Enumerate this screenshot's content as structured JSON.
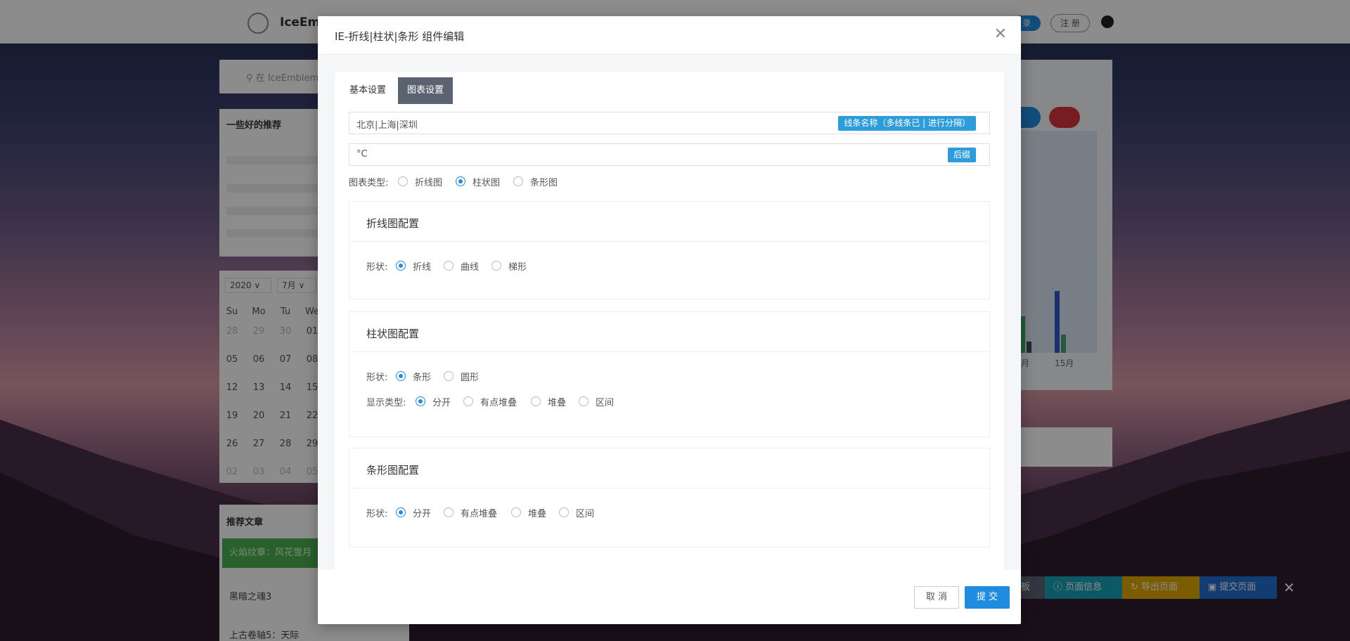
{
  "app": {
    "logo_text": "IceEml",
    "login_label": "录",
    "register_label": "注 册"
  },
  "sidebar": {
    "search_placeholder": "在 IceEmblem 中",
    "recommend_title": "一些好的推荐",
    "calendar": {
      "year": "2020",
      "month": "7月",
      "weekdays": [
        "Su",
        "Mo",
        "Tu",
        "We"
      ],
      "rows": [
        [
          "28",
          "29",
          "30",
          "01"
        ],
        [
          "05",
          "06",
          "07",
          "08"
        ],
        [
          "12",
          "13",
          "14",
          "15"
        ],
        [
          "19",
          "20",
          "21",
          "22"
        ],
        [
          "26",
          "27",
          "28",
          "29"
        ],
        [
          "02",
          "03",
          "04",
          "05"
        ]
      ]
    },
    "articles": {
      "title": "推荐文章",
      "highlight": "火焰纹章：风花雪月",
      "items": [
        "黑暗之魂3",
        "上古卷轴5：天际"
      ]
    }
  },
  "right_panel": {
    "axis_labels": [
      "月",
      "15月"
    ]
  },
  "bottom_bar": {
    "board_label": "板",
    "page_info": "页面信息",
    "export_label": "导出页面",
    "submit_page": "提交页面"
  },
  "modal": {
    "title": "IE-折线|柱状|条形 组件编辑",
    "tabs": [
      {
        "label": "基本设置"
      },
      {
        "label": "图表设置"
      }
    ],
    "series_field": {
      "value": "北京|上海|深圳",
      "tag": "线条名称（多线条已 | 进行分隔）"
    },
    "suffix_field": {
      "value": "°C",
      "tag": "后缀"
    },
    "chart_type": {
      "label": "图表类型:",
      "options": [
        "折线图",
        "柱状图",
        "条形图"
      ],
      "selected": "柱状图"
    },
    "line_config": {
      "title": "折线图配置",
      "shape": {
        "label": "形状:",
        "options": [
          "折线",
          "曲线",
          "梯形"
        ],
        "selected": "折线"
      }
    },
    "bar_config": {
      "title": "柱状图配置",
      "shape": {
        "label": "形状:",
        "options": [
          "条形",
          "圆形"
        ],
        "selected": "条形"
      },
      "display": {
        "label": "显示类型:",
        "options": [
          "分开",
          "有点堆叠",
          "堆叠",
          "区间"
        ],
        "selected": "分开"
      }
    },
    "hbar_config": {
      "title": "条形图配置",
      "shape": {
        "label": "形状:",
        "options": [
          "分开",
          "有点堆叠",
          "堆叠",
          "区间"
        ],
        "selected": "分开"
      }
    },
    "cancel_label": "取 消",
    "submit_label": "提 交"
  },
  "colors": {
    "primary": "#1f8ce0",
    "tab_active": "#5b6372",
    "tag": "#2d9cdb",
    "success": "#4caf50",
    "danger": "#d9363e"
  }
}
